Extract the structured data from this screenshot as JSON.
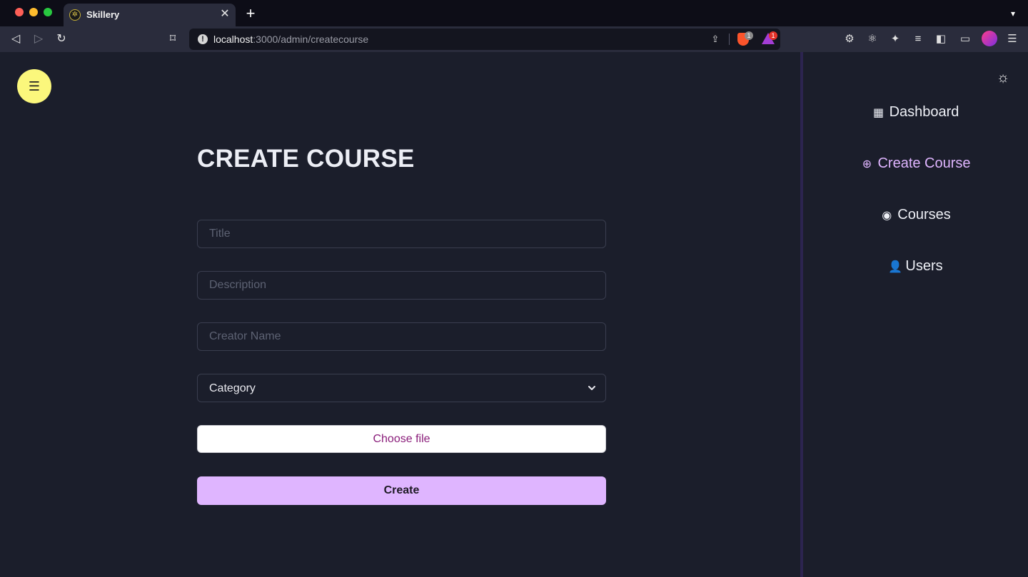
{
  "browser": {
    "tab_title": "Skillery",
    "url_host": "localhost",
    "url_path": ":3000/admin/createcourse",
    "shield_badge": "1",
    "rewards_badge": "1"
  },
  "page": {
    "heading": "CREATE COURSE",
    "form": {
      "title_placeholder": "Title",
      "description_placeholder": "Description",
      "creator_placeholder": "Creator Name",
      "category_value": "Category",
      "file_label": "Choose file",
      "submit_label": "Create"
    }
  },
  "sidebar": {
    "items": [
      {
        "label": "Dashboard",
        "icon": "dashboard-icon"
      },
      {
        "label": "Create Course",
        "icon": "plus-circle-icon"
      },
      {
        "label": "Courses",
        "icon": "eye-icon"
      },
      {
        "label": "Users",
        "icon": "user-icon"
      }
    ]
  },
  "colors": {
    "accent": "#dfb5ff",
    "fab": "#fbf77c",
    "background": "#1b1e2b"
  }
}
